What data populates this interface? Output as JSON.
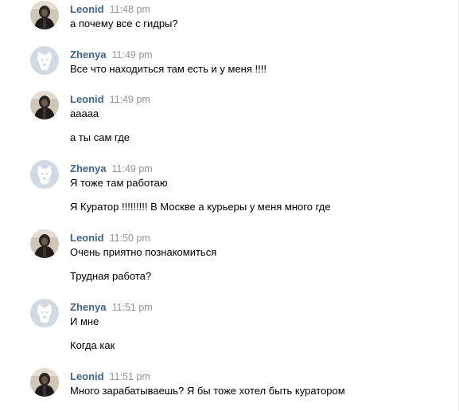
{
  "messages": [
    {
      "author": "Leonid",
      "time": "11:48 pm",
      "lines": [
        "а почему все с гидры?"
      ]
    },
    {
      "author": "Zhenya",
      "time": "11:49 pm",
      "lines": [
        "Все что находиться там есть и у меня !!!!"
      ]
    },
    {
      "author": "Leonid",
      "time": "11:49 pm",
      "lines": [
        "ааааа",
        "а ты сам где"
      ]
    },
    {
      "author": "Zhenya",
      "time": "11:49 pm",
      "lines": [
        "Я тоже там работаю",
        "Я Куратор !!!!!!!!! В Москве а курьеры у меня много где"
      ]
    },
    {
      "author": "Leonid",
      "time": "11:50 pm",
      "lines": [
        "Очень приятно познакомиться",
        "Трудная работа?"
      ]
    },
    {
      "author": "Zhenya",
      "time": "11:51 pm",
      "lines": [
        "И мне",
        "Когда как"
      ]
    },
    {
      "author": "Leonid",
      "time": "11:51 pm",
      "lines": [
        "Много зарабатываешь? Я бы тоже хотел быть куратором"
      ]
    }
  ],
  "avatars": {
    "leonid": "photo-avatar",
    "zhenya": "default-dog-avatar"
  },
  "colors": {
    "author_name": "#42648b",
    "timestamp": "#939699",
    "text": "#000000",
    "default_avatar_bg": "#d1d9e3"
  }
}
